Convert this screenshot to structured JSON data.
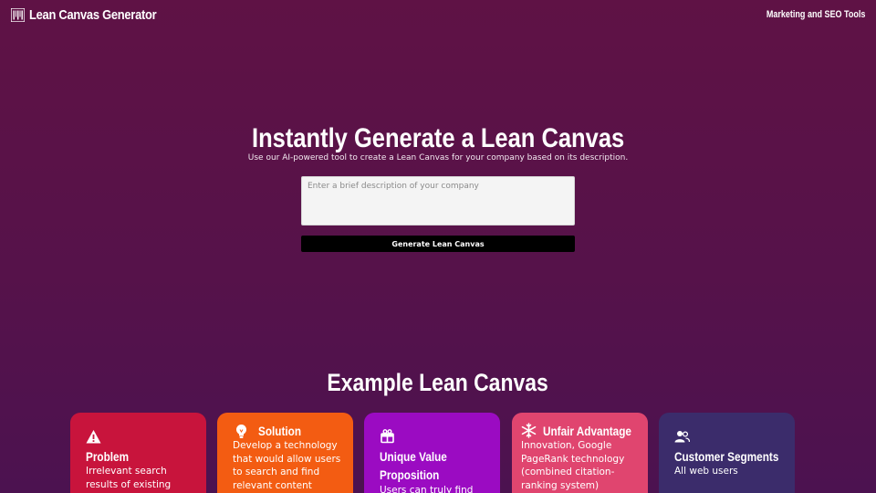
{
  "header": {
    "brand": "Lean Canvas Generator",
    "brand_icon": "barcode-icon",
    "nav_link": "Marketing and SEO Tools"
  },
  "hero": {
    "title": "Instantly Generate a Lean Canvas",
    "subtitle": "Use our AI-powered tool to create a Lean Canvas for your company based on its description.",
    "input_placeholder": "Enter a brief description of your company",
    "input_value": "",
    "button_label": "Generate Lean Canvas"
  },
  "examples": {
    "title": "Example Lean Canvas",
    "cards": [
      {
        "title": "Problem",
        "icon": "warning-icon",
        "color": "#c8143c",
        "text": "Irrelevant search results of existing"
      },
      {
        "title": "Solution",
        "icon": "lightbulb-icon",
        "color": "#f35c12",
        "text": "Develop a technology that would allow users to search and find relevant content"
      },
      {
        "title": "Unique Value Proposition",
        "icon": "gift-icon",
        "color": "#9b0bc2",
        "text": "Users can truly find"
      },
      {
        "title": "Unfair Advantage",
        "icon": "snowflake-icon",
        "color": "#e0456f",
        "text": "Innovation, Google PageRank technology (combined citation-ranking system)"
      },
      {
        "title": "Customer Segments",
        "icon": "users-icon",
        "color": "#3b2c6b",
        "text": "All web users"
      }
    ]
  },
  "colors": {
    "background_top": "#5f1245",
    "background_bottom": "#4c1250",
    "button": "#000000"
  }
}
